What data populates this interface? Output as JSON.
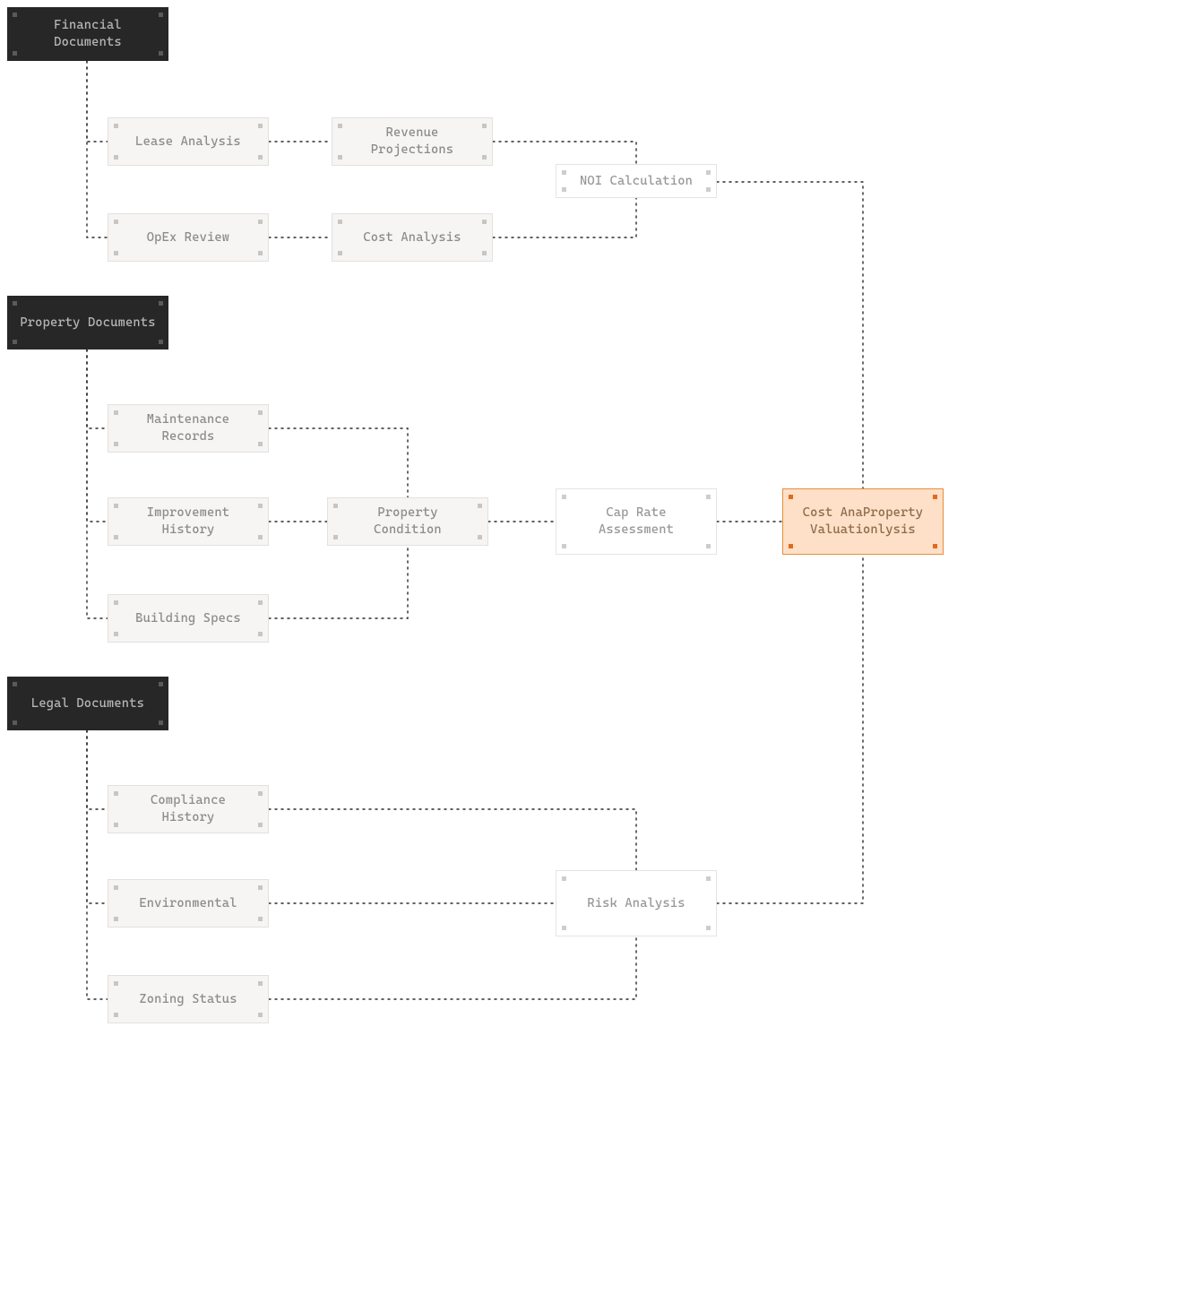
{
  "diagram": {
    "type": "flow",
    "connector_style": "dotted",
    "headers": {
      "financial": "Financial Documents",
      "property": "Property Documents",
      "legal": "Legal Documents"
    },
    "nodes": {
      "lease_analysis": "Lease Analysis",
      "revenue_projections": "Revenue Projections",
      "opex_review": "OpEx Review",
      "cost_analysis": "Cost Analysis",
      "noi_calculation": "NOI Calculation",
      "maintenance_records": "Maintenance Records",
      "improvement_history": "Improvement History",
      "building_specs": "Building Specs",
      "property_condition": "Property Condition",
      "cap_rate_assessment": "Cap Rate Assessment",
      "property_valuation": "Cost AnaProperty Valuationlysis",
      "compliance_history": "Compliance History",
      "environmental": "Environmental",
      "zoning_status": "Zoning Status",
      "risk_analysis": "Risk Analysis"
    }
  }
}
